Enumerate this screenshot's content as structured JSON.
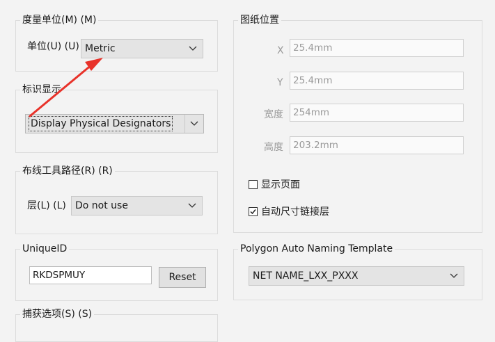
{
  "measurement": {
    "title": "度量单位(M) (M)",
    "unit_label": "单位(U) (U)",
    "unit_value": "Metric"
  },
  "designator": {
    "title": "标识显示",
    "value": "Display Physical Designators"
  },
  "routing": {
    "title": "布线工具路径(R) (R)",
    "layer_label": "层(L) (L)",
    "layer_value": "Do not use"
  },
  "unique_id": {
    "title": "UniqueID",
    "value": "RKDSPMUY",
    "reset_label": "Reset"
  },
  "snap": {
    "title": "捕获选项(S) (S)"
  },
  "sheet_position": {
    "title": "图纸位置",
    "x_label": "X",
    "x_value": "25.4mm",
    "y_label": "Y",
    "y_value": "25.4mm",
    "width_label": "宽度",
    "width_value": "254mm",
    "height_label": "高度",
    "height_value": "203.2mm",
    "show_page_label": "显示页面",
    "show_page_checked": false,
    "auto_size_label": "自动尺寸链接层",
    "auto_size_checked": true
  },
  "polygon": {
    "title": "Polygon Auto Naming Template",
    "value": "NET NAME_LXX_PXXX"
  },
  "annotation": {
    "arrow_color": "#e8322a"
  }
}
